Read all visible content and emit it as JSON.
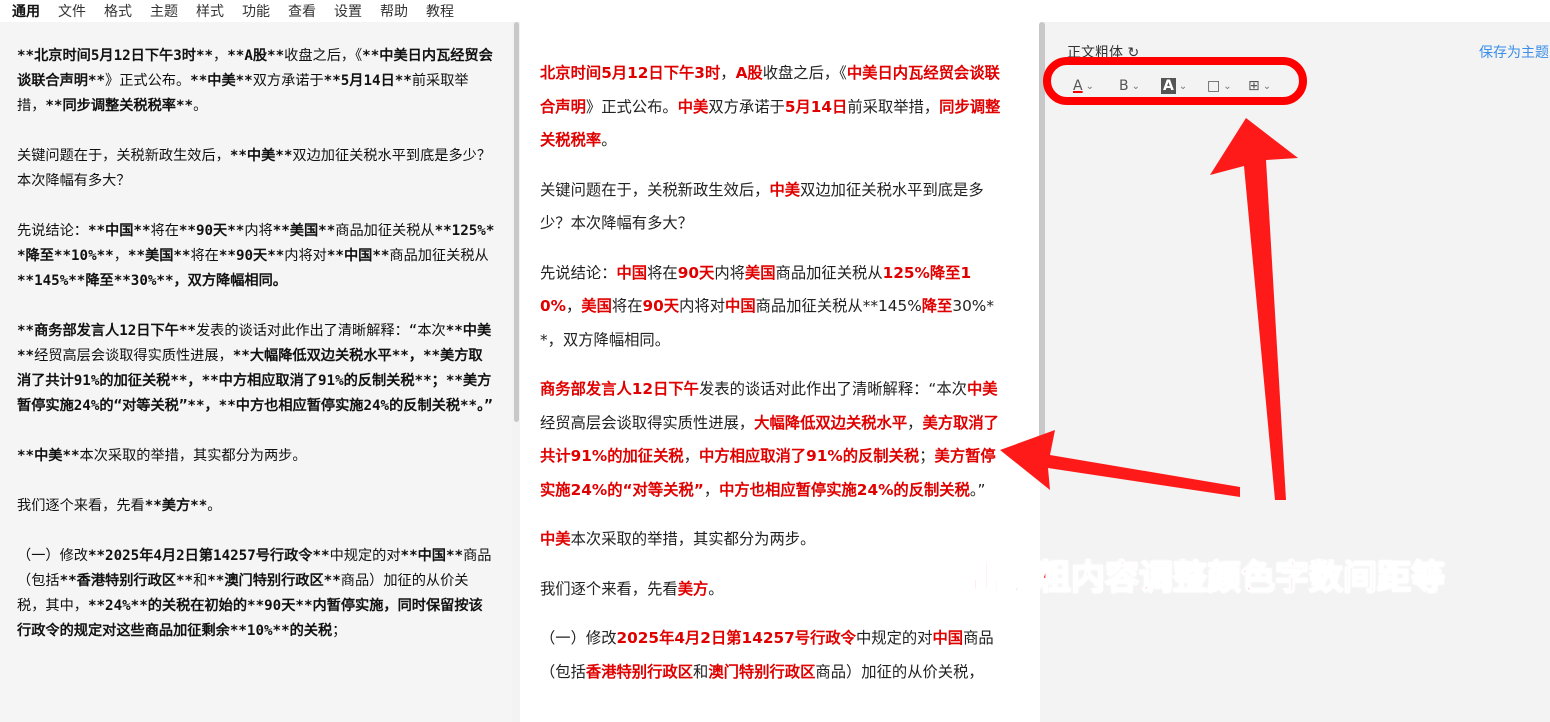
{
  "menu": [
    "通用",
    "文件",
    "格式",
    "主题",
    "样式",
    "功能",
    "查看",
    "设置",
    "帮助",
    "教程"
  ],
  "editor": {
    "paragraphs": [
      [
        [
          "b",
          "**北京时间5月12日下午3时**"
        ],
        [
          "n",
          "，"
        ],
        [
          "b",
          "**A股**"
        ],
        [
          "n",
          "收盘之后，《"
        ],
        [
          "b",
          "**中美日内瓦经贸会谈联合声明**"
        ],
        [
          "n",
          "》正式公布。"
        ],
        [
          "b",
          "**中美**"
        ],
        [
          "n",
          "双方承诺于"
        ],
        [
          "b",
          "**5月14日**"
        ],
        [
          "n",
          "前采取举措，"
        ],
        [
          "b",
          "**同步调整关税税率**"
        ],
        [
          "n",
          "。"
        ]
      ],
      [
        [
          "n",
          "关键问题在于，关税新政生效后，"
        ],
        [
          "b",
          "**中美**"
        ],
        [
          "n",
          "双边加征关税水平到底是多少？本次降幅有多大？"
        ]
      ],
      [
        [
          "n",
          "先说结论："
        ],
        [
          "b",
          "**中国**"
        ],
        [
          "n",
          "将在"
        ],
        [
          "b",
          "**90天**"
        ],
        [
          "n",
          "内将"
        ],
        [
          "b",
          "**美国**"
        ],
        [
          "n",
          "商品加征关税从"
        ],
        [
          "b",
          "**125%**降至**10%**"
        ],
        [
          "n",
          "，"
        ],
        [
          "b",
          "**美国**"
        ],
        [
          "n",
          "将在"
        ],
        [
          "b",
          "**90天**"
        ],
        [
          "n",
          "内将对"
        ],
        [
          "b",
          "**中国**"
        ],
        [
          "n",
          "商品加征关税从"
        ],
        [
          "b",
          "**145%**降至**30%**，双方降幅相同。"
        ]
      ],
      [
        [
          "b",
          "**商务部发言人12日下午**"
        ],
        [
          "n",
          "发表的谈话对此作出了清晰解释："
        ],
        [
          "n",
          "“本次"
        ],
        [
          "b",
          "**中美**"
        ],
        [
          "n",
          "经贸高层会谈取得实质性进展，"
        ],
        [
          "b",
          "**大幅降低双边关税水平**，**美方取消了共计91%的加征关税**，**中方相应取消了91%的反制关税**；**美方暂停实施24%的“对等关税”**，**中方也相应暂停实施24%的反制关税**。”"
        ]
      ],
      [
        [
          "b",
          "**中美**"
        ],
        [
          "n",
          "本次采取的举措，其实都分为两步。"
        ]
      ],
      [
        [
          "n",
          "我们逐个来看，先看"
        ],
        [
          "b",
          "**美方**"
        ],
        [
          "n",
          "。"
        ]
      ],
      [
        [
          "n",
          "（一）修改"
        ],
        [
          "b",
          "**2025年4月2日第14257号行政令**"
        ],
        [
          "n",
          "中规定的对"
        ],
        [
          "b",
          "**中国**"
        ],
        [
          "n",
          "商品（包括"
        ],
        [
          "b",
          "**香港特别行政区**"
        ],
        [
          "n",
          "和"
        ],
        [
          "b",
          "**澳门特别行政区**"
        ],
        [
          "n",
          "商品）加征的从价关税，其中，"
        ],
        [
          "b",
          "**24%**的关税在初始的**90天**内暂停实施，同时保留按该行政令的规定对这些商品加征剩余**10%**的关税"
        ],
        [
          "n",
          "；"
        ]
      ]
    ]
  },
  "preview": {
    "paragraphs": [
      [
        [
          "r",
          "北京时间5月12日下午3时"
        ],
        [
          "n",
          "，"
        ],
        [
          "r",
          "A股"
        ],
        [
          "n",
          "收盘之后，《"
        ],
        [
          "r",
          "中美日内瓦经贸会谈联合声明"
        ],
        [
          "n",
          "》正式公布。"
        ],
        [
          "r",
          "中美"
        ],
        [
          "n",
          "双方承诺于"
        ],
        [
          "r",
          "5月14日"
        ],
        [
          "n",
          "前采取举措，"
        ],
        [
          "r",
          "同步调整关税税率"
        ],
        [
          "n",
          "。"
        ]
      ],
      [
        [
          "n",
          "关键问题在于，关税新政生效后，"
        ],
        [
          "r",
          "中美"
        ],
        [
          "n",
          "双边加征关税水平到底是多少？本次降幅有多大？"
        ]
      ],
      [
        [
          "n",
          "先说结论："
        ],
        [
          "r",
          "中国"
        ],
        [
          "n",
          "将在"
        ],
        [
          "r",
          "90天"
        ],
        [
          "n",
          "内将"
        ],
        [
          "r",
          "美国"
        ],
        [
          "n",
          "商品加征关税从"
        ],
        [
          "r",
          "125%降至10%"
        ],
        [
          "n",
          "，"
        ],
        [
          "r",
          "美国"
        ],
        [
          "n",
          "将在"
        ],
        [
          "r",
          "90天"
        ],
        [
          "n",
          "内将对"
        ],
        [
          "r",
          "中国"
        ],
        [
          "n",
          "商品加征关税从**145%"
        ],
        [
          "r",
          "降至"
        ],
        [
          "n",
          "30%**，双方降幅相同。"
        ]
      ],
      [
        [
          "r",
          "商务部发言人12日下午"
        ],
        [
          "n",
          "发表的谈话对此作出了清晰解释：“本次"
        ],
        [
          "r",
          "中美"
        ],
        [
          "n",
          "经贸高层会谈取得实质性进展，"
        ],
        [
          "r",
          "大幅降低双边关税水平"
        ],
        [
          "n",
          "，"
        ],
        [
          "r",
          "美方取消了共计91%的加征关税"
        ],
        [
          "n",
          "，"
        ],
        [
          "r",
          "中方相应取消了91%的反制关税"
        ],
        [
          "n",
          "；"
        ],
        [
          "r",
          "美方暂停实施24%的“对等关税”"
        ],
        [
          "n",
          "，"
        ],
        [
          "r",
          "中方也相应暂停实施24%的反制关税"
        ],
        [
          "n",
          "。”"
        ]
      ],
      [
        [
          "r",
          "中美"
        ],
        [
          "n",
          "本次采取的举措，其实都分为两步。"
        ]
      ],
      [
        [
          "n",
          "我们逐个来看，先看"
        ],
        [
          "r",
          "美方"
        ],
        [
          "n",
          "。"
        ]
      ],
      [
        [
          "n",
          "（一）修改"
        ],
        [
          "r",
          "2025年4月2日第14257号行政令"
        ],
        [
          "n",
          "中规定的对"
        ],
        [
          "r",
          "中国"
        ],
        [
          "n",
          "商品（包括"
        ],
        [
          "r",
          "香港特别行政区"
        ],
        [
          "n",
          "和"
        ],
        [
          "r",
          "澳门特别行政区"
        ],
        [
          "n",
          "商品）加征的从价关税，"
        ]
      ]
    ]
  },
  "panel": {
    "theme_label": "正文粗体 ↻",
    "save_label": "保存为主题"
  },
  "toolbar": {
    "font_color": "A",
    "bold": "B",
    "bg_color": "A",
    "border": "□",
    "spacing": "⊞"
  },
  "annotation": "点击加粗内容调整颜色字数间距等",
  "colors": {
    "highlight": "#e00000",
    "annotation": "#ff1a1a",
    "link": "#3b8ee8"
  }
}
